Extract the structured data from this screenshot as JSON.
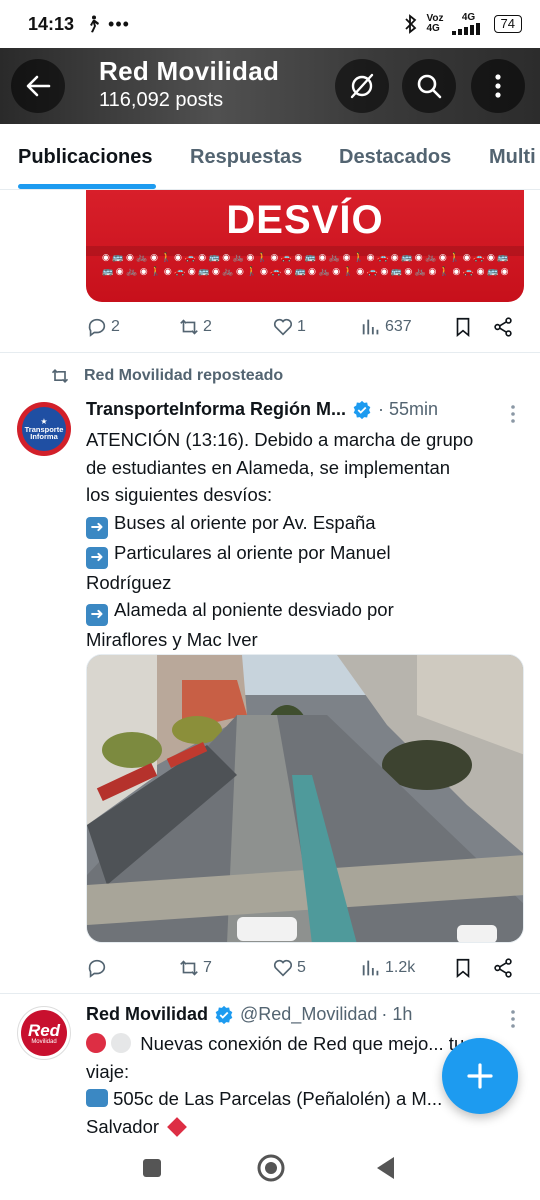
{
  "status_bar": {
    "time": "14:13",
    "carrier_1": "Voz",
    "carrier_2": "4G",
    "network": "4G",
    "battery": "74"
  },
  "header": {
    "title": "Red Movilidad",
    "post_count": "116,092 posts"
  },
  "tabs": [
    {
      "label": "Publicaciones",
      "active": true
    },
    {
      "label": "Respuestas",
      "active": false
    },
    {
      "label": "Destacados",
      "active": false
    },
    {
      "label": "Multi",
      "active": false
    }
  ],
  "post_1": {
    "image_text": "DESVÍO",
    "actions": {
      "replies": "2",
      "reposts": "2",
      "likes": "1",
      "views": "637"
    }
  },
  "post_2": {
    "repost_label": "Red Movilidad reposteado",
    "author": "TransporteInforma Región M...",
    "time": "· 55min",
    "lines": [
      "ATENCIÓN (13:16). Debido a marcha de grupo",
      "de estudiantes en Alameda, se implementan",
      "los siguientes desvíos:",
      "Buses al oriente por Av. España",
      "Particulares al oriente por Manuel",
      "Rodríguez",
      "Alameda al poniente desviado por",
      "Miraflores y Mac Iver"
    ],
    "avatar_text_1": "Transporte",
    "avatar_text_2": "Informa",
    "actions": {
      "replies": "",
      "reposts": "7",
      "likes": "5",
      "views": "1.2k"
    }
  },
  "post_3": {
    "author": "Red Movilidad",
    "handle": "@Red_Movilidad",
    "time": "· 1h",
    "line_1": "Nuevas conexión de Red que mejo... tu",
    "line_2": "viaje:",
    "line_3": "505c de Las Parcelas (Peñalolén) a M...",
    "line_4": "Salvador",
    "avatar_text": "Red",
    "avatar_sub": "Movilidad"
  },
  "colors": {
    "accent": "#1d9bf0",
    "brand_red": "#d81f2a",
    "muted": "#536471"
  }
}
